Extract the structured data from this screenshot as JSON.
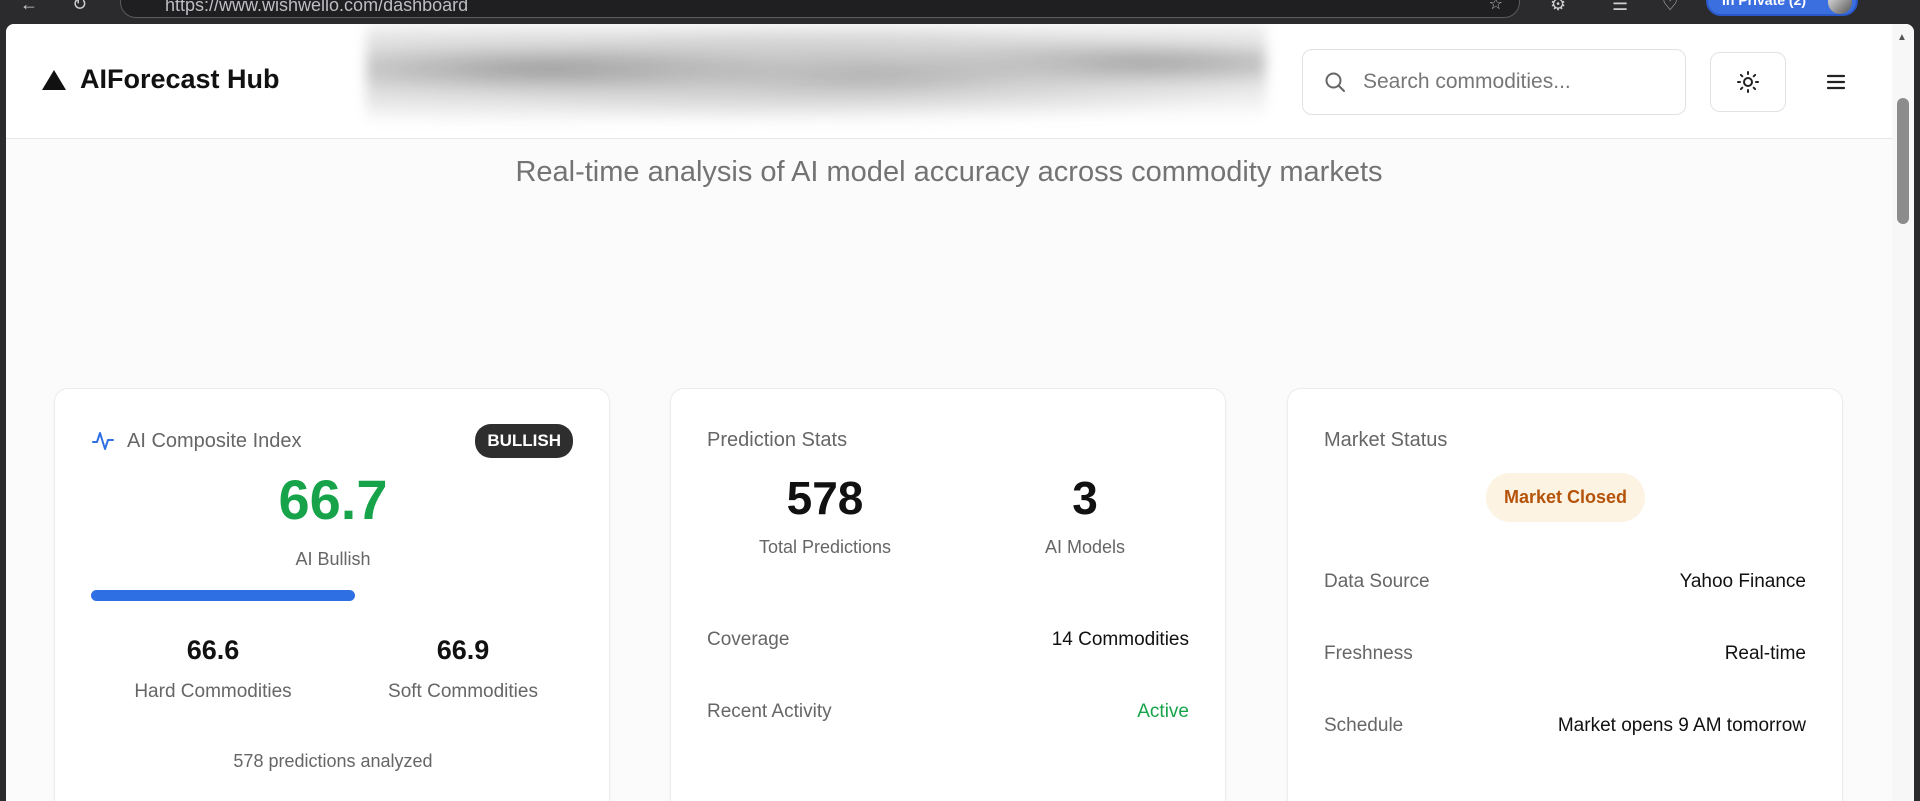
{
  "browser": {
    "url": "https://www.wishwello.com/dashboard",
    "profile_label": "In Private (2)"
  },
  "header": {
    "logo_text": "AIForecast Hub",
    "search_placeholder": "Search commodities..."
  },
  "subtitle": "Real-time analysis of AI model accuracy across commodity markets",
  "composite": {
    "title": "AI Composite Index",
    "badge": "BULLISH",
    "value": "66.7",
    "value_color": "#16a34a",
    "label": "AI Bullish",
    "progress_fraction": 0.545,
    "hard_value": "66.6",
    "hard_label": "Hard Commodities",
    "soft_value": "66.9",
    "soft_label": "Soft Commodities",
    "analyzed": "578 predictions analyzed"
  },
  "prediction_stats": {
    "title": "Prediction Stats",
    "total_value": "578",
    "total_label": "Total Predictions",
    "models_value": "3",
    "models_label": "AI Models",
    "coverage_label": "Coverage",
    "coverage_value": "14 Commodities",
    "activity_label": "Recent Activity",
    "activity_value": "Active"
  },
  "market_status": {
    "title": "Market Status",
    "badge": "Market Closed",
    "source_label": "Data Source",
    "source_value": "Yahoo Finance",
    "freshness_label": "Freshness",
    "freshness_value": "Real-time",
    "schedule_label": "Schedule",
    "schedule_value": "Market opens 9 AM tomorrow"
  },
  "colors": {
    "accent_blue": "#2f6fe4",
    "bullish_green": "#16a34a",
    "closed_amber": "#b45309"
  }
}
